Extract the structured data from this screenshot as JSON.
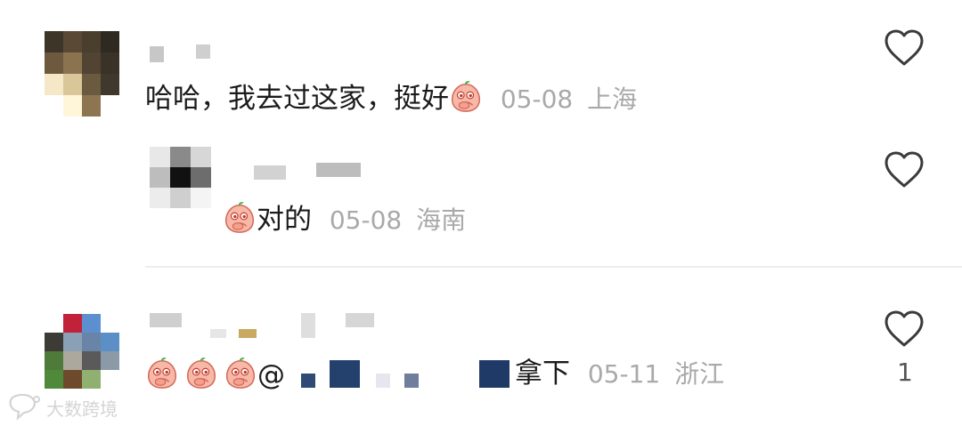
{
  "comments": [
    {
      "text": "哈哈，我去过这家，挺好",
      "date": "05-08",
      "location": "上海",
      "like_icon": "heart-outline-icon",
      "reply": {
        "text": "对的",
        "date": "05-08",
        "location": "海南",
        "like_icon": "heart-outline-icon"
      }
    },
    {
      "mention_prefix": "@",
      "text": "拿下",
      "date": "05-11",
      "location": "浙江",
      "like_icon": "heart-outline-icon",
      "like_count": "1"
    }
  ],
  "watermark": {
    "text": "大数跨境",
    "icon": "chat-bubble-logo-icon"
  },
  "colors": {
    "meta": "#a9a9a9",
    "divider": "#eeeeee",
    "text": "#1b1b1b"
  }
}
